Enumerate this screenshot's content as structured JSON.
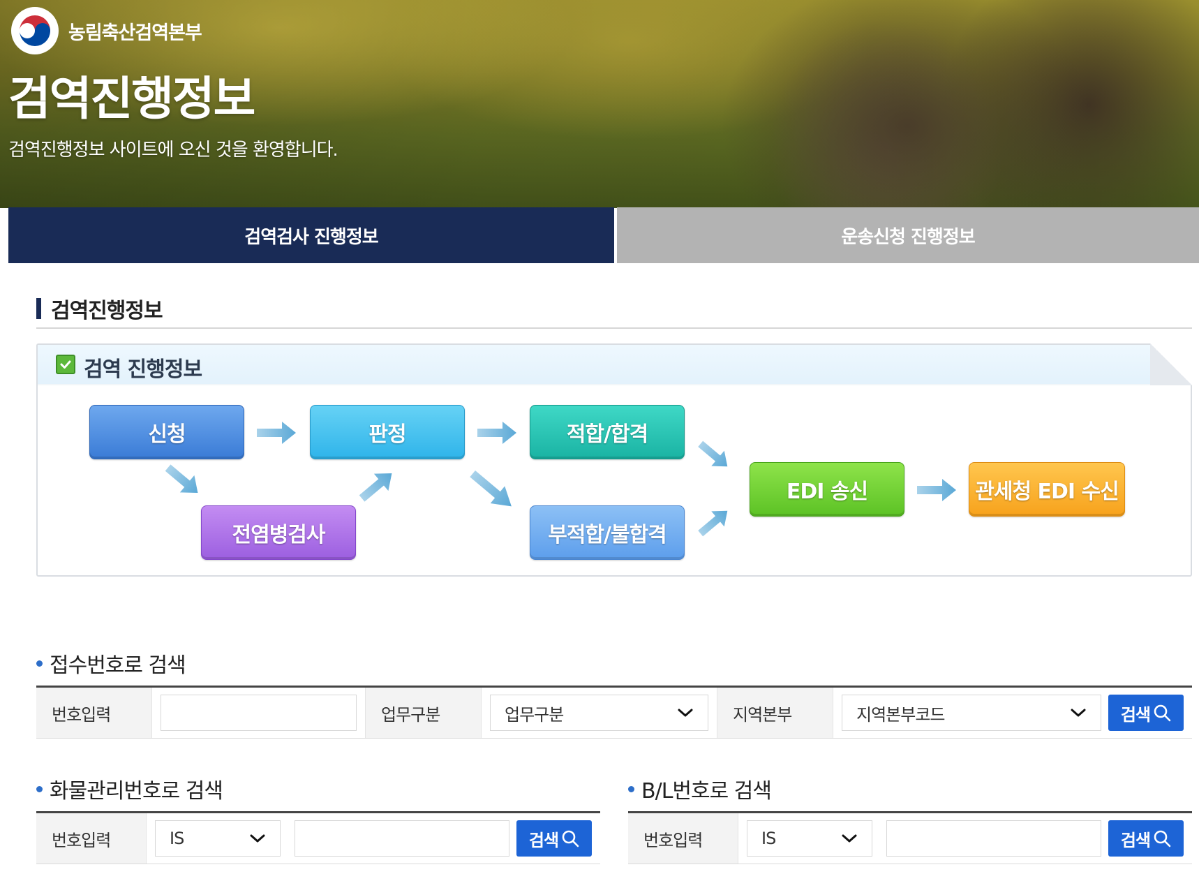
{
  "header": {
    "org_name": "농림축산검역본부",
    "title": "검역진행정보",
    "welcome": "검역진행정보 사이트에 오신 것을 환영합니다."
  },
  "tabs": [
    {
      "label": "검역검사 진행정보",
      "active": true
    },
    {
      "label": "운송신청 진행정보",
      "active": false
    }
  ],
  "section": {
    "title": "검역진행정보"
  },
  "flow": {
    "title": "검역 진행정보",
    "steps": {
      "apply": "신청",
      "judge": "판정",
      "pass": "적합/합격",
      "infect": "전염병검사",
      "fail": "부적합/불합격",
      "edi_send": "EDI 송신",
      "customs": "관세청 EDI 수신"
    }
  },
  "receipt_search": {
    "title": "접수번호로 검색",
    "number_label": "번호입력",
    "number_value": "",
    "work_label": "업무구분",
    "work_selected": "업무구분",
    "region_label": "지역본부",
    "region_selected": "지역본부코드",
    "search_button": "검색"
  },
  "cargo_search": {
    "title": "화물관리번호로 검색",
    "number_label": "번호입력",
    "prefix_selected": "IS",
    "number_value": "",
    "search_button": "검색"
  },
  "bl_search": {
    "title": "B/L번호로 검색",
    "number_label": "번호입력",
    "prefix_selected": "IS",
    "number_value": "",
    "search_button": "검색"
  },
  "colors": {
    "navy": "#192b56",
    "search_blue": "#1d64d6"
  }
}
